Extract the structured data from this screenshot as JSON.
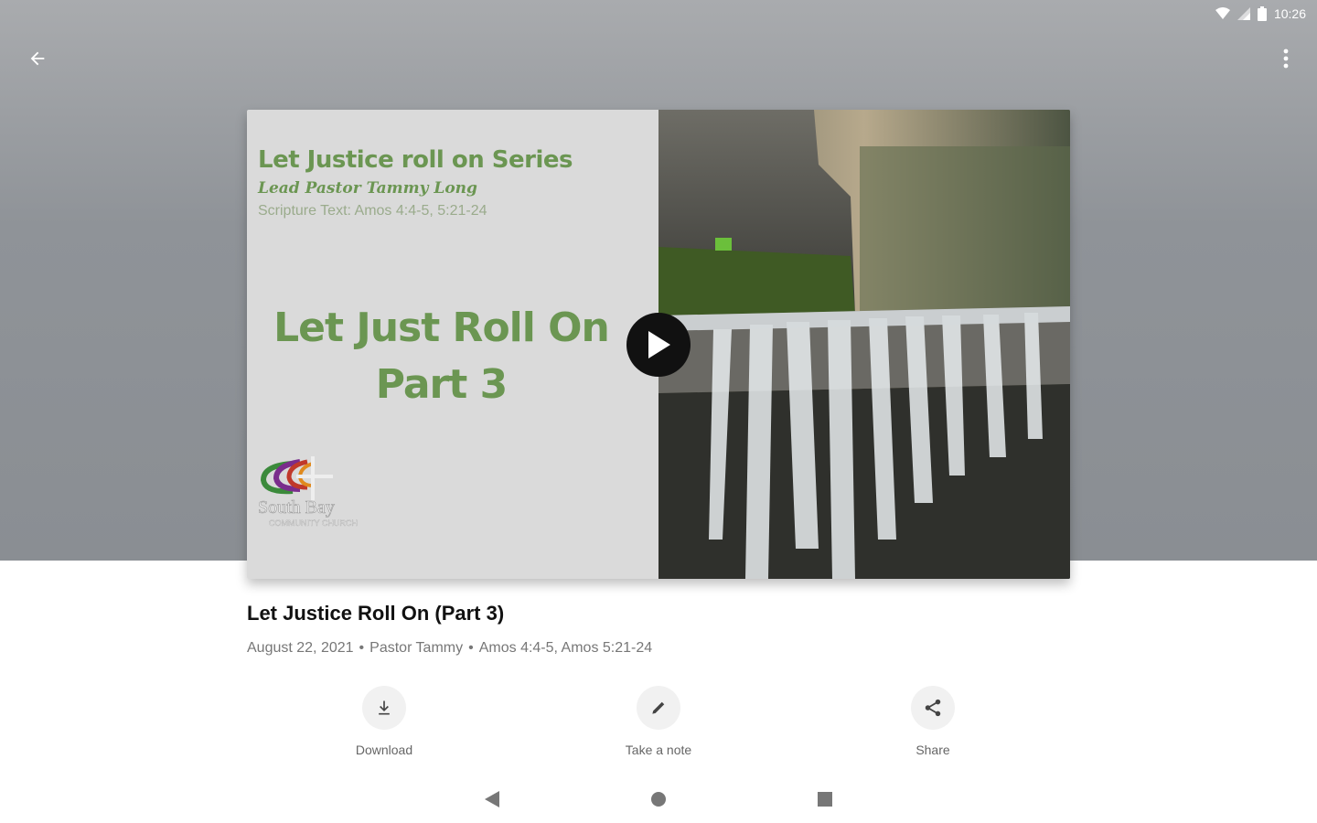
{
  "status_bar": {
    "time": "10:26",
    "icons": [
      "wifi-icon",
      "signal-icon",
      "battery-icon"
    ]
  },
  "app_bar": {
    "back_icon": "arrow-back-icon",
    "menu_icon": "more-vert-icon"
  },
  "thumbnail": {
    "series_title": "Let Justice roll on Series",
    "pastor_line": "Lead Pastor Tammy Long",
    "scripture_line": "Scripture Text: Amos 4:4-5, 5:21-24",
    "big_title_line1": "Let Just Roll On",
    "big_title_line2": "Part 3",
    "logo_text_line1": "South Bay",
    "logo_text_line2": "COMMUNITY CHURCH",
    "play_icon": "play-icon"
  },
  "sermon": {
    "title": "Let Justice Roll On (Part 3)",
    "date": "August 22, 2021",
    "speaker": "Pastor Tammy",
    "passages": "Amos 4:4-5, Amos 5:21-24",
    "separator": "•"
  },
  "actions": [
    {
      "label": "Download",
      "icon": "download-icon"
    },
    {
      "label": "Take a note",
      "icon": "pencil-icon"
    },
    {
      "label": "Share",
      "icon": "share-icon"
    }
  ],
  "nav": {
    "back": "nav-back-icon",
    "home": "nav-home-icon",
    "recents": "nav-recents-icon"
  },
  "colors": {
    "accent_green": "#6b9652",
    "header_gray": "#8f9398"
  }
}
